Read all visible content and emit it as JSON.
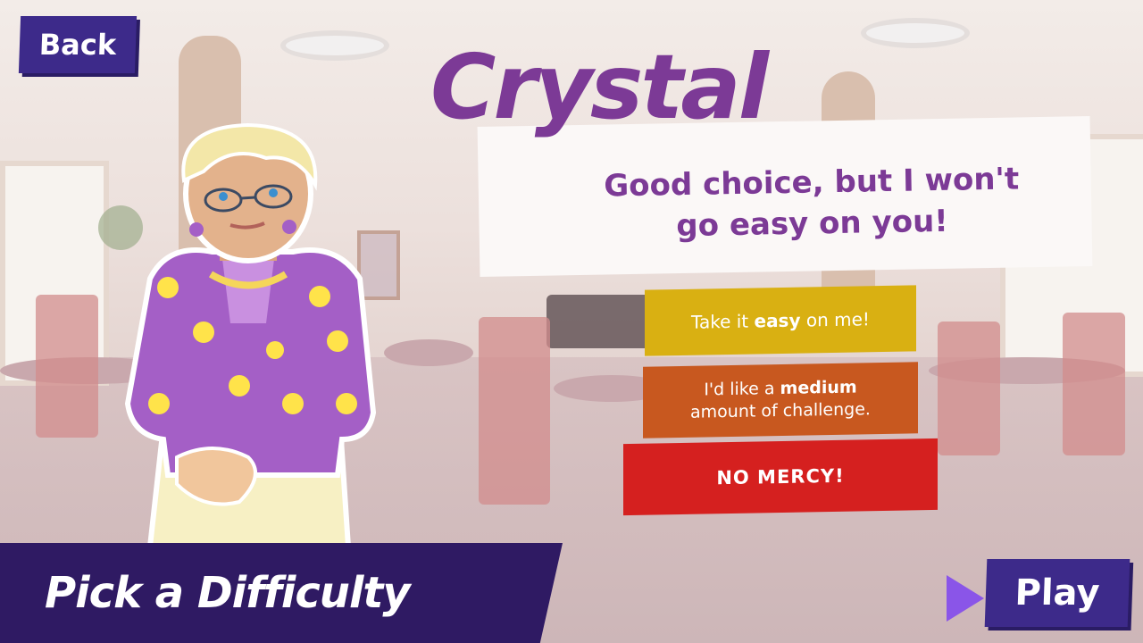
{
  "back_label": "Back",
  "character_name": "Crystal",
  "speech": "Good choice, but I won't go easy on you!",
  "difficulty": {
    "easy": {
      "prefix": "Take it ",
      "bold": "easy",
      "suffix": " on me!"
    },
    "medium": {
      "prefix": "I'd like a ",
      "bold": "medium",
      "line2": "amount of challenge."
    },
    "hard": {
      "label": "NO MERCY!"
    }
  },
  "footer_title": "Pick a Difficulty",
  "play_label": "Play",
  "icons": {
    "play_arrow": "play-arrow-icon"
  },
  "colors": {
    "primary": "#3d2a8a",
    "name": "#7c3a96",
    "easy": "#d9b012",
    "medium": "#c8581f",
    "hard": "#d5201f",
    "footer": "#2f1a63"
  }
}
